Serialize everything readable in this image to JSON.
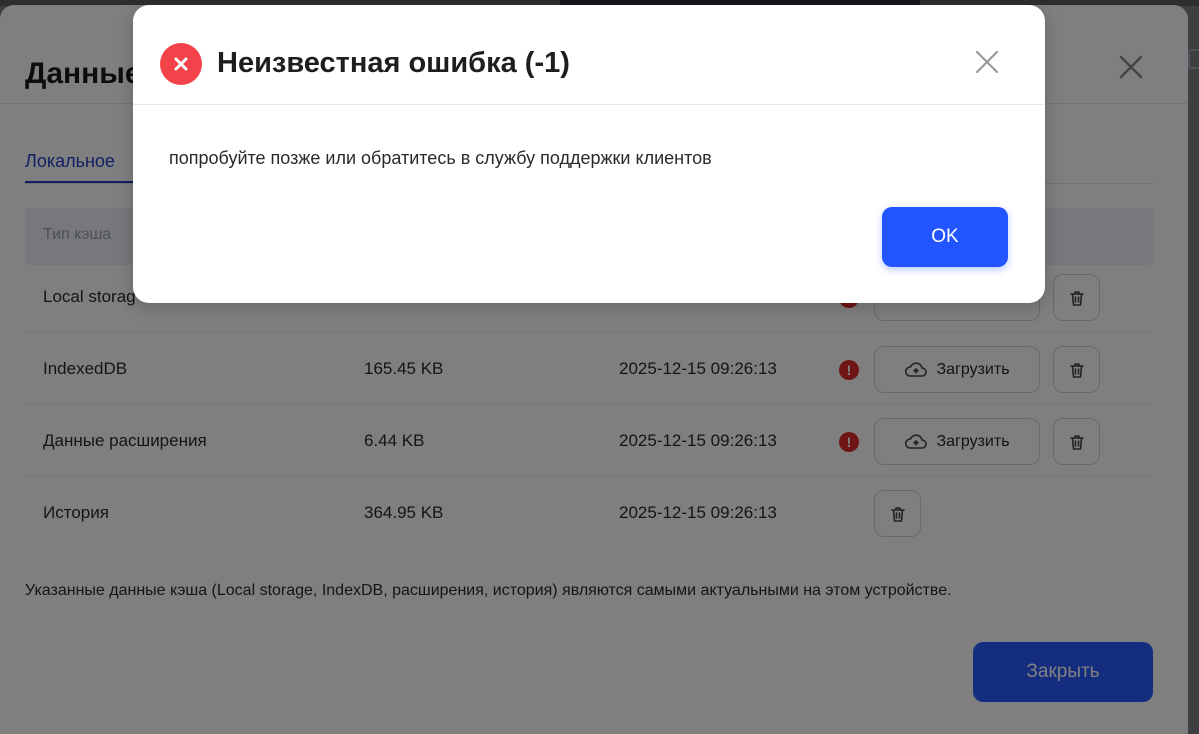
{
  "panel": {
    "title": "Данные",
    "tab_label": "Локальное",
    "table_header_type": "Тип кэша",
    "rows": [
      {
        "name": "Local storag",
        "size": "",
        "date": ""
      },
      {
        "name": "IndexedDB",
        "size": "165.45 KB",
        "date": "2025-12-15 09:26:13",
        "upload": "Загрузить"
      },
      {
        "name": "Данные расширения",
        "size": "6.44 KB",
        "date": "2025-12-15 09:26:13",
        "upload": "Загрузить"
      },
      {
        "name": "История",
        "size": "364.95 KB",
        "date": "2025-12-15 09:26:13"
      }
    ],
    "footnote": "Указанные данные кэша (Local storage, IndexDB, расширения, история) являются самыми актуальными на этом устройстве.",
    "close_label": "Закрыть",
    "upload_label": "Загрузить"
  },
  "dialog": {
    "title": "Неизвестная ошибка (-1)",
    "message": "попробуйте позже или обратитесь в службу поддержки клиентов",
    "ok_label": "OK"
  },
  "colors": {
    "accent": "#2255ff",
    "error": "#f2424a",
    "warning": "#e02b2b",
    "overlay": "rgba(0,0,0,0.5)"
  }
}
